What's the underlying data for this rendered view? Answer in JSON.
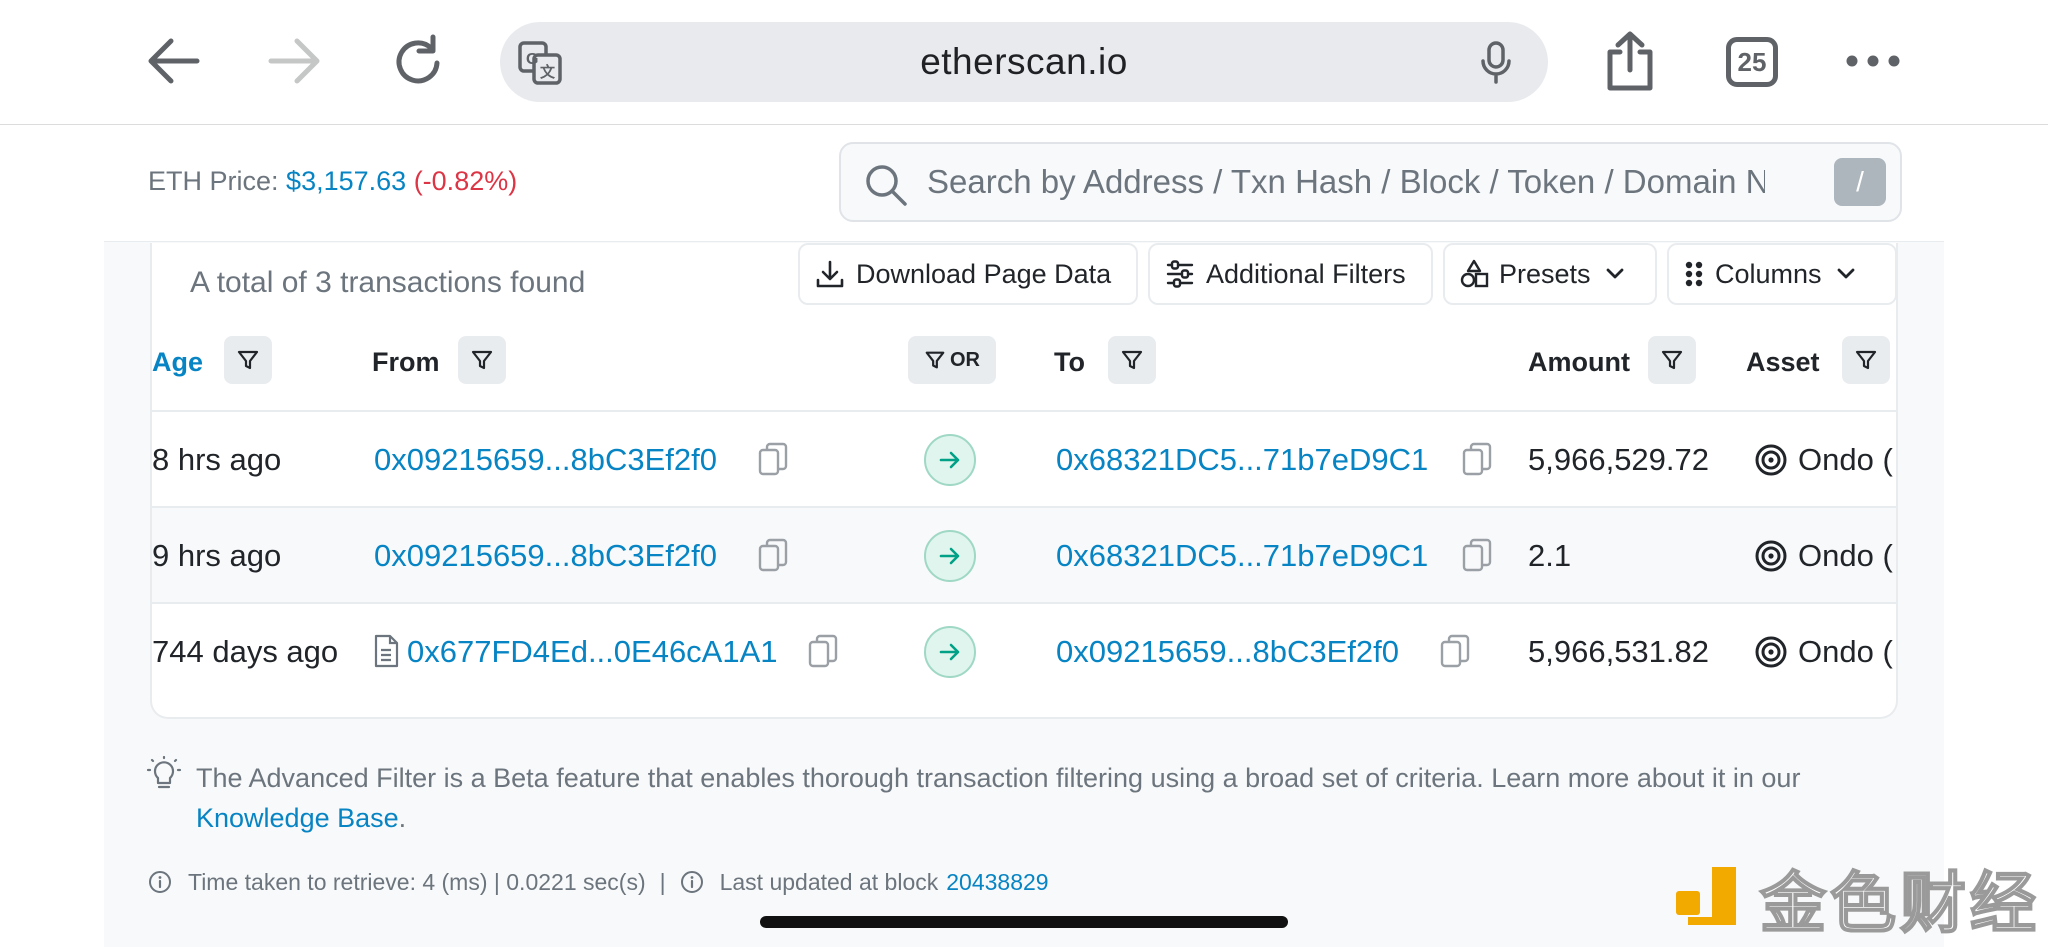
{
  "browser": {
    "url": "etherscan.io",
    "tabs_count": "25"
  },
  "header": {
    "eth_price_label": "ETH Price:",
    "eth_price_value": "$3,157.63",
    "eth_price_change": "(-0.82%)",
    "search_placeholder": "Search by Address / Txn Hash / Block / Token / Domain Name",
    "search_shortcut": "/"
  },
  "card": {
    "total_text": "A total of 3 transactions found",
    "toolbar": {
      "download": "Download Page Data",
      "filters": "Additional Filters",
      "presets": "Presets",
      "columns": "Columns"
    },
    "columns": {
      "age": "Age",
      "from": "From",
      "or": "OR",
      "to": "To",
      "amount": "Amount",
      "asset": "Asset"
    },
    "rows": [
      {
        "age": "8 hrs ago",
        "from": "0x09215659...8bC3Ef2f0",
        "to": "0x68321DC5...71b7eD9C1",
        "amount": "5,966,529.72",
        "asset": "Ondo ("
      },
      {
        "age": "9 hrs ago",
        "from": "0x09215659...8bC3Ef2f0",
        "to": "0x68321DC5...71b7eD9C1",
        "amount": "2.1",
        "asset": "Ondo ("
      },
      {
        "age": "744 days ago",
        "from": "0x677FD4Ed...0E46cA1A1",
        "to": "0x09215659...8bC3Ef2f0",
        "amount": "5,966,531.82",
        "asset": "Ondo ("
      }
    ]
  },
  "note": {
    "text": "The Advanced Filter is a Beta feature that enables thorough transaction filtering using a broad set of criteria. Learn more about it in our ",
    "link": "Knowledge Base",
    "end": "."
  },
  "footer": {
    "time_taken": "Time taken to retrieve: 4 (ms) | 0.0221 sec(s)",
    "separator": "|",
    "last_updated_label": "Last updated at block",
    "last_updated_block": "20438829"
  },
  "watermark": {
    "text": "金色财经"
  },
  "colors": {
    "link": "#0784c3",
    "negative": "#dc3545",
    "muted": "#6c757d",
    "in_badge": "#e0f5ee"
  }
}
